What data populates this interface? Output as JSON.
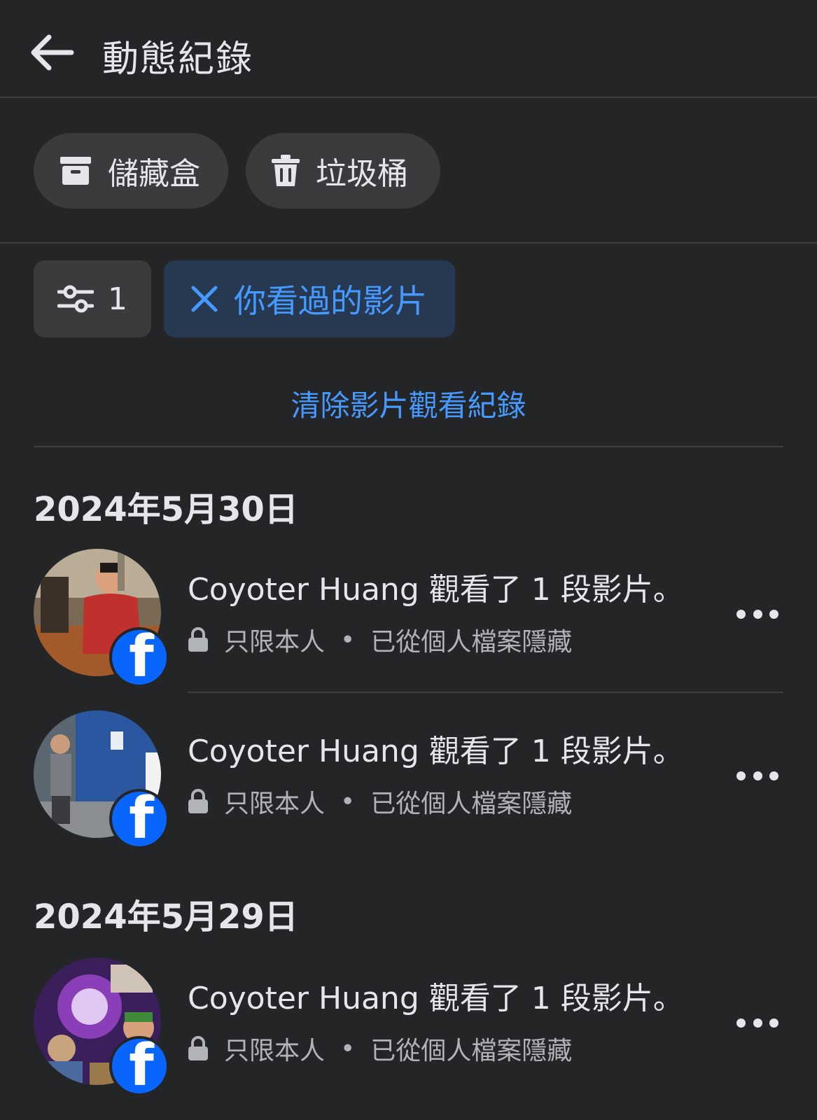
{
  "header": {
    "title": "動態紀錄",
    "back_icon": "arrow-left-icon"
  },
  "actions": {
    "archive_label": "儲藏盒",
    "archive_icon": "archive-box-icon",
    "trash_label": "垃圾桶",
    "trash_icon": "trash-can-icon"
  },
  "filters": {
    "count": "1",
    "count_icon": "filter-sliders-icon",
    "active_filter_label": "你看過的影片",
    "active_filter_icon": "close-x-icon"
  },
  "clear_link": "清除影片觀看紀錄",
  "sections": [
    {
      "date": "2024年5月30日",
      "entries": [
        {
          "title": "Coyoter Huang 觀看了 1 段影片。",
          "privacy": "只限本人",
          "separator": "•",
          "status": "已從個人檔案隱藏"
        },
        {
          "title": "Coyoter Huang 觀看了 1 段影片。",
          "privacy": "只限本人",
          "separator": "•",
          "status": "已從個人檔案隱藏"
        }
      ]
    },
    {
      "date": "2024年5月29日",
      "entries": [
        {
          "title": "Coyoter Huang 觀看了 1 段影片。",
          "privacy": "只限本人",
          "separator": "•",
          "status": "已從個人檔案隱藏"
        }
      ]
    }
  ],
  "colors": {
    "background": "#242526",
    "accent": "#4599ff",
    "facebook_blue": "#0866ff",
    "chip_bg": "#3a3b3c",
    "active_chip_bg": "#263951"
  }
}
